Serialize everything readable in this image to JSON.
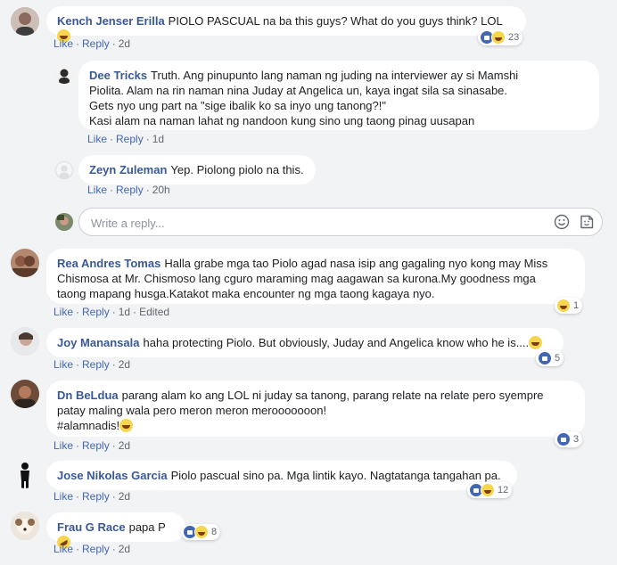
{
  "actions": {
    "like": "Like",
    "reply": "Reply",
    "edited": "Edited",
    "dot": "·"
  },
  "comments": [
    {
      "author": "Kench Jenser Erilla",
      "text": "PIOLO PASCUAL na ba this guys? What do you guys think? LOL",
      "time": "2d",
      "reaction_count": "23"
    },
    {
      "author": "Dee Tricks",
      "text": "Truth. Ang pinupunto lang naman ng juding na interviewer ay si Mamshi\nPiolita. Alam na rin naman nina Juday at Angelica un, kaya ingat sila sa sinasabe.\nGets nyo ung part na \"sige ibalik ko sa inyo ung tanong?!\"\nKasi alam na naman lahat ng nandoon kung sino ung taong pinag uusapan",
      "time": "1d"
    },
    {
      "author": "Zeyn Zuleman",
      "text": "Yep. Piolong piolo na this.",
      "time": "20h"
    },
    {
      "author": "Rea Andres Tomas",
      "text": "Halla grabe mga tao Piolo agad nasa isip ang gagaling nyo kong may Miss\nChismosa at Mr. Chismoso lang cguro maraming mag aagawan sa kurona.My goodness mga\ntaong mapang husga.Katakot maka encounter ng mga taong kagaya nyo.",
      "time": "1d",
      "reaction_count": "1"
    },
    {
      "author": "Joy Manansala",
      "text": "haha protecting Piolo. But obviously, Juday and Angelica know who he is....",
      "time": "2d",
      "reaction_count": "5"
    },
    {
      "author": "Dn BeLdua",
      "text": "parang alam ko ang LOL ni juday sa tanong, parang relate na relate pero syempre\npatay maling wala pero meron meron merooooooon!\n#alamnadis!",
      "time": "2d",
      "reaction_count": "3"
    },
    {
      "author": "Jose Nikolas Garcia",
      "text": "Piolo pascual sino pa. Mga lintik kayo. Nagtatanga tangahan pa.",
      "time": "2d",
      "reaction_count": "12"
    },
    {
      "author": "Frau G Race",
      "text": "papa P",
      "time": "2d",
      "reaction_count": "8"
    }
  ],
  "reply_box": {
    "placeholder": "Write a reply..."
  },
  "colors": {
    "author": "#385898",
    "link": "#4267b2",
    "meta": "#606770",
    "bubble": "#ffffff",
    "page": "#f2f3f5"
  },
  "icons": [
    "smiley-icon",
    "sticker-icon",
    "like-reaction-icon",
    "haha-reaction-icon",
    "laughing-emoji",
    "rofl-emoji"
  ]
}
